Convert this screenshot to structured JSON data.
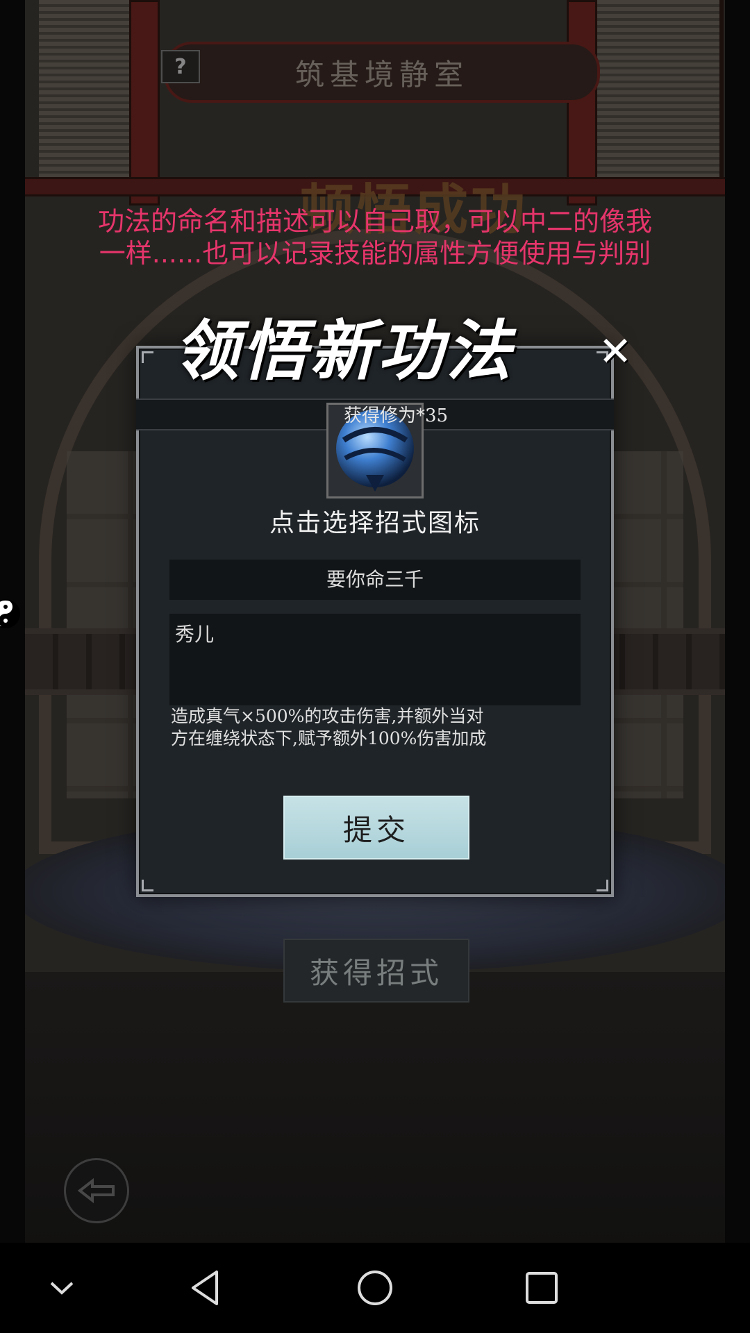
{
  "background": {
    "room_title": "筑基境静室",
    "help_label": "?",
    "banner_text": "顿悟成功",
    "obtain_move_label": "获得招式"
  },
  "caption": {
    "line1": "功法的命名和描述可以自己取，可以中二的像我",
    "line2": "一样......也可以记录技能的属性方便使用与判别",
    "color": "#e6356b"
  },
  "dialog": {
    "title": "领悟新功法",
    "close_label": "✕",
    "gain_text": "获得修为*35",
    "select_icon_label": "点击选择招式图标",
    "name_value": "要你命三千",
    "description_value": "秀儿",
    "effect_text_line1": "造成真气×500%的攻击伤害,并额外当对",
    "effect_text_line2": "方在缠绕状态下,赋予额外100%伤害加成",
    "submit_label": "提交"
  },
  "icons": {
    "skill_icon": "blue-sphere-icon",
    "back": "back-arrow-icon",
    "side": "yin-yang-icon"
  },
  "navbar": {
    "items": [
      "chevron-down-icon",
      "back-triangle-icon",
      "home-circle-icon",
      "recents-square-icon"
    ]
  }
}
